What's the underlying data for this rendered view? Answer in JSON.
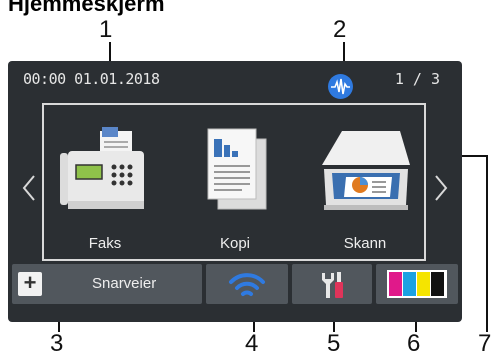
{
  "heading": "Hjemmeskjerm",
  "status": {
    "clock": "00:00  01.01.2018",
    "page_indicator": "1 / 3",
    "signal_icon": "wireless-signal-icon"
  },
  "apps": [
    {
      "label": "Faks",
      "icon": "fax-machine-icon"
    },
    {
      "label": "Kopi",
      "icon": "copy-documents-icon"
    },
    {
      "label": "Skann",
      "icon": "scanner-icon"
    }
  ],
  "nav": {
    "prev_icon": "chevron-left-icon",
    "next_icon": "chevron-right-icon"
  },
  "bottom_bar": {
    "shortcuts_label": "Snarveier",
    "shortcuts_icon": "plus-icon",
    "wifi_icon": "wifi-icon",
    "settings_icon": "settings-tools-icon",
    "toner_icon": "toner-icon"
  },
  "callouts": [
    "1",
    "2",
    "3",
    "4",
    "5",
    "6",
    "7"
  ],
  "colors": {
    "screen_bg": "#2b2f33",
    "button_bg": "#51575d",
    "accent_blue": "#2f7ae0",
    "toner": [
      "#e0198a",
      "#1ba1e2",
      "#f5e400",
      "#111111"
    ]
  }
}
